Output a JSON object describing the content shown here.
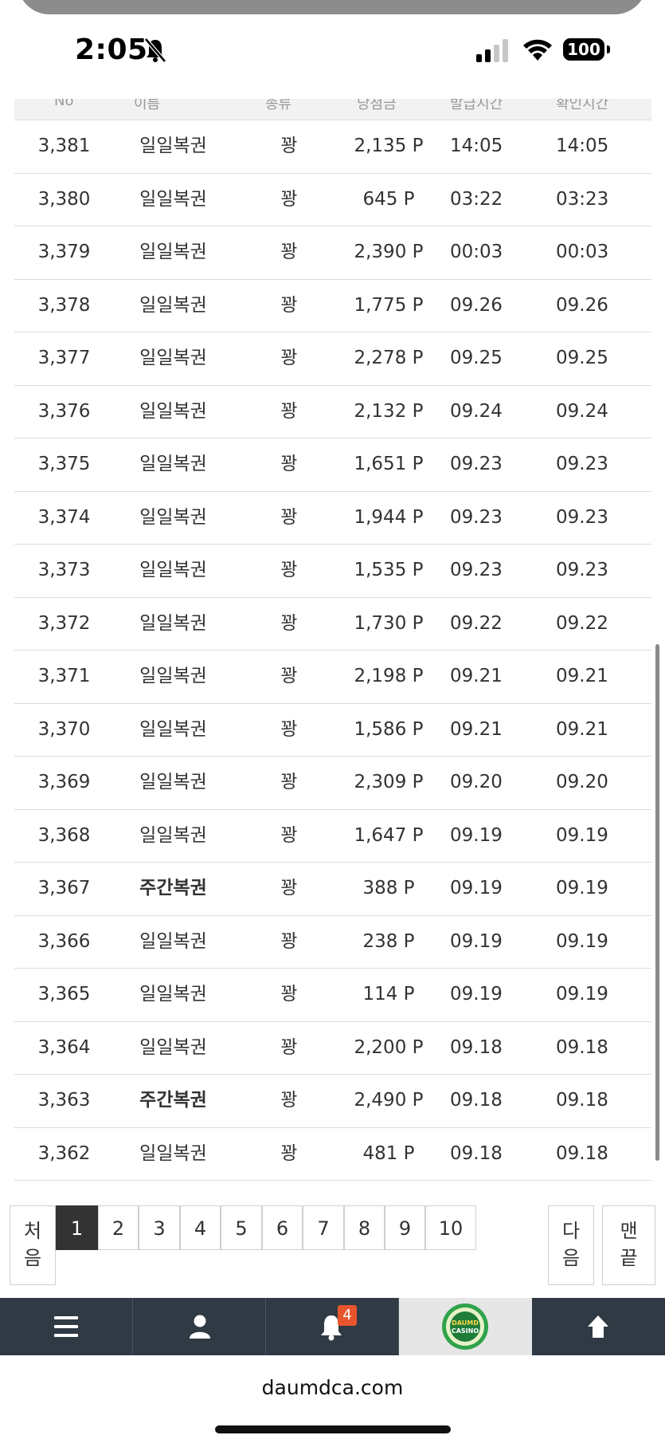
{
  "status": {
    "time": "2:05",
    "battery": "100"
  },
  "header_partial": [
    "No",
    "이름",
    "종류",
    "당첨금",
    "발급시간",
    "확인시간"
  ],
  "rows": [
    {
      "no": "3,381",
      "name": "일일복권",
      "type": "꽝",
      "points": "2,135 P",
      "issued": "14:05",
      "checked": "14:05",
      "bold": false
    },
    {
      "no": "3,380",
      "name": "일일복권",
      "type": "꽝",
      "points": "645 P",
      "issued": "03:22",
      "checked": "03:23",
      "bold": false
    },
    {
      "no": "3,379",
      "name": "일일복권",
      "type": "꽝",
      "points": "2,390 P",
      "issued": "00:03",
      "checked": "00:03",
      "bold": false
    },
    {
      "no": "3,378",
      "name": "일일복권",
      "type": "꽝",
      "points": "1,775 P",
      "issued": "09.26",
      "checked": "09.26",
      "bold": false
    },
    {
      "no": "3,377",
      "name": "일일복권",
      "type": "꽝",
      "points": "2,278 P",
      "issued": "09.25",
      "checked": "09.25",
      "bold": false
    },
    {
      "no": "3,376",
      "name": "일일복권",
      "type": "꽝",
      "points": "2,132 P",
      "issued": "09.24",
      "checked": "09.24",
      "bold": false
    },
    {
      "no": "3,375",
      "name": "일일복권",
      "type": "꽝",
      "points": "1,651 P",
      "issued": "09.23",
      "checked": "09.23",
      "bold": false
    },
    {
      "no": "3,374",
      "name": "일일복권",
      "type": "꽝",
      "points": "1,944 P",
      "issued": "09.23",
      "checked": "09.23",
      "bold": false
    },
    {
      "no": "3,373",
      "name": "일일복권",
      "type": "꽝",
      "points": "1,535 P",
      "issued": "09.23",
      "checked": "09.23",
      "bold": false
    },
    {
      "no": "3,372",
      "name": "일일복권",
      "type": "꽝",
      "points": "1,730 P",
      "issued": "09.22",
      "checked": "09.22",
      "bold": false
    },
    {
      "no": "3,371",
      "name": "일일복권",
      "type": "꽝",
      "points": "2,198 P",
      "issued": "09.21",
      "checked": "09.21",
      "bold": false
    },
    {
      "no": "3,370",
      "name": "일일복권",
      "type": "꽝",
      "points": "1,586 P",
      "issued": "09.21",
      "checked": "09.21",
      "bold": false
    },
    {
      "no": "3,369",
      "name": "일일복권",
      "type": "꽝",
      "points": "2,309 P",
      "issued": "09.20",
      "checked": "09.20",
      "bold": false
    },
    {
      "no": "3,368",
      "name": "일일복권",
      "type": "꽝",
      "points": "1,647 P",
      "issued": "09.19",
      "checked": "09.19",
      "bold": false
    },
    {
      "no": "3,367",
      "name": "주간복권",
      "type": "꽝",
      "points": "388 P",
      "issued": "09.19",
      "checked": "09.19",
      "bold": true
    },
    {
      "no": "3,366",
      "name": "일일복권",
      "type": "꽝",
      "points": "238 P",
      "issued": "09.19",
      "checked": "09.19",
      "bold": false
    },
    {
      "no": "3,365",
      "name": "일일복권",
      "type": "꽝",
      "points": "114 P",
      "issued": "09.19",
      "checked": "09.19",
      "bold": false
    },
    {
      "no": "3,364",
      "name": "일일복권",
      "type": "꽝",
      "points": "2,200 P",
      "issued": "09.18",
      "checked": "09.18",
      "bold": false
    },
    {
      "no": "3,363",
      "name": "주간복권",
      "type": "꽝",
      "points": "2,490 P",
      "issued": "09.18",
      "checked": "09.18",
      "bold": true
    },
    {
      "no": "3,362",
      "name": "일일복권",
      "type": "꽝",
      "points": "481 P",
      "issued": "09.18",
      "checked": "09.18",
      "bold": false
    }
  ],
  "pagination": {
    "first": "처음",
    "pages": [
      "1",
      "2",
      "3",
      "4",
      "5",
      "6",
      "7",
      "8",
      "9",
      "10"
    ],
    "current": "1",
    "next": "다음",
    "last": "맨끝"
  },
  "nav": {
    "notification_count": "4",
    "logo_text": "DAUMD CASINO"
  },
  "browser": {
    "url": "daumdca.com"
  },
  "colors": {
    "nav_bg": "#2f3a44",
    "badge": "#e8542c",
    "active_page": "#333333"
  }
}
